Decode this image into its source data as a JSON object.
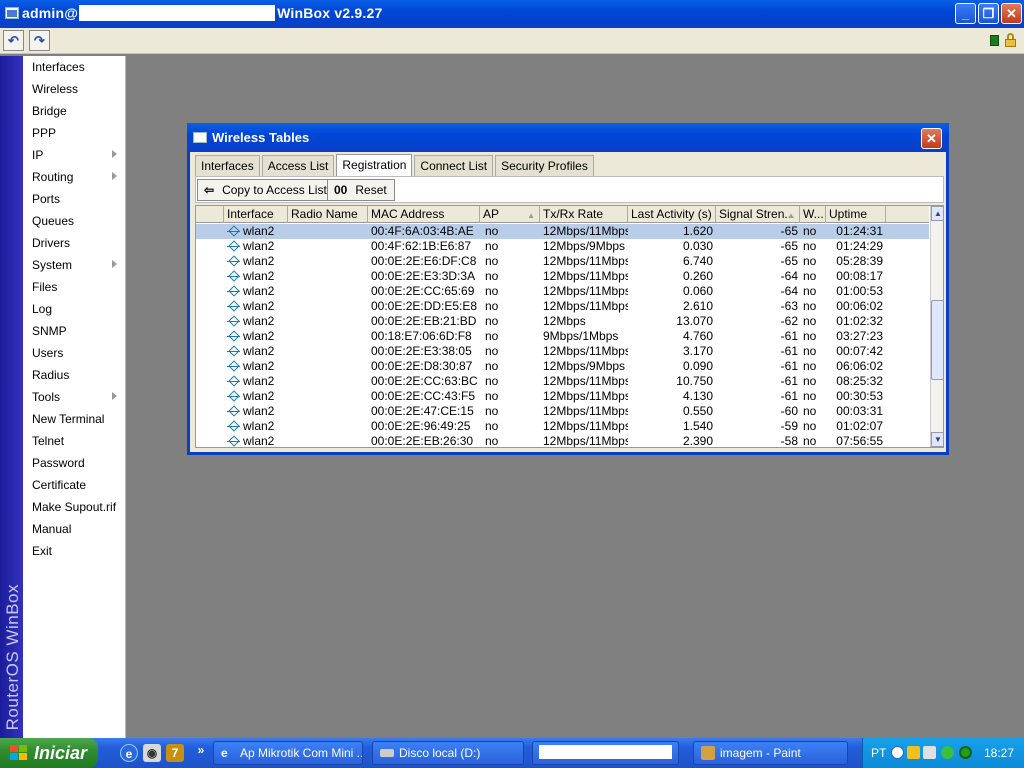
{
  "window": {
    "title_prefix": "admin@",
    "title_suffix": "WinBox v2.9.27",
    "minimize": "_",
    "maximize": "❐",
    "close": "✕"
  },
  "toolbar": {
    "undo": "↶",
    "redo": "↷"
  },
  "brand": "RouterOS WinBox",
  "menu": {
    "items": [
      {
        "label": "Interfaces",
        "submenu": false
      },
      {
        "label": "Wireless",
        "submenu": false
      },
      {
        "label": "Bridge",
        "submenu": false
      },
      {
        "label": "PPP",
        "submenu": false
      },
      {
        "label": "IP",
        "submenu": true
      },
      {
        "label": "Routing",
        "submenu": true
      },
      {
        "label": "Ports",
        "submenu": false
      },
      {
        "label": "Queues",
        "submenu": false
      },
      {
        "label": "Drivers",
        "submenu": false
      },
      {
        "label": "System",
        "submenu": true
      },
      {
        "label": "Files",
        "submenu": false
      },
      {
        "label": "Log",
        "submenu": false
      },
      {
        "label": "SNMP",
        "submenu": false
      },
      {
        "label": "Users",
        "submenu": false
      },
      {
        "label": "Radius",
        "submenu": false
      },
      {
        "label": "Tools",
        "submenu": true
      },
      {
        "label": "New Terminal",
        "submenu": false
      },
      {
        "label": "Telnet",
        "submenu": false
      },
      {
        "label": "Password",
        "submenu": false
      },
      {
        "label": "Certificate",
        "submenu": false
      },
      {
        "label": "Make Supout.rif",
        "submenu": false
      },
      {
        "label": "Manual",
        "submenu": false
      },
      {
        "label": "Exit",
        "submenu": false
      }
    ]
  },
  "wireless_tables": {
    "title": "Wireless Tables",
    "close": "✕",
    "tabs": [
      {
        "label": "Interfaces",
        "active": false
      },
      {
        "label": "Access List",
        "active": false
      },
      {
        "label": "Registration",
        "active": true
      },
      {
        "label": "Connect List",
        "active": false
      },
      {
        "label": "Security Profiles",
        "active": false
      }
    ],
    "actions": {
      "copy_icon": "⇦",
      "copy_label": "Copy to Access List",
      "reset_icon": "00",
      "reset_label": "Reset"
    },
    "columns": [
      "Interface",
      "Radio Name",
      "MAC Address",
      "AP",
      "Tx/Rx Rate",
      "Last Activity (s)",
      "Signal Stren...",
      "W...",
      "Uptime"
    ],
    "rows": [
      {
        "interface": "wlan2",
        "radio_name": "",
        "mac": "00:4F:6A:03:4B:AE",
        "ap": "no",
        "rate": "12Mbps/11Mbps",
        "last_activity": "1.620",
        "signal": "-65",
        "w": "no",
        "uptime": "01:24:31",
        "selected": true
      },
      {
        "interface": "wlan2",
        "radio_name": "",
        "mac": "00:4F:62:1B:E6:87",
        "ap": "no",
        "rate": "12Mbps/9Mbps",
        "last_activity": "0.030",
        "signal": "-65",
        "w": "no",
        "uptime": "01:24:29",
        "selected": false
      },
      {
        "interface": "wlan2",
        "radio_name": "",
        "mac": "00:0E:2E:E6:DF:C8",
        "ap": "no",
        "rate": "12Mbps/11Mbps",
        "last_activity": "6.740",
        "signal": "-65",
        "w": "no",
        "uptime": "05:28:39",
        "selected": false
      },
      {
        "interface": "wlan2",
        "radio_name": "",
        "mac": "00:0E:2E:E3:3D:3A",
        "ap": "no",
        "rate": "12Mbps/11Mbps",
        "last_activity": "0.260",
        "signal": "-64",
        "w": "no",
        "uptime": "00:08:17",
        "selected": false
      },
      {
        "interface": "wlan2",
        "radio_name": "",
        "mac": "00:0E:2E:CC:65:69",
        "ap": "no",
        "rate": "12Mbps/11Mbps",
        "last_activity": "0.060",
        "signal": "-64",
        "w": "no",
        "uptime": "01:00:53",
        "selected": false
      },
      {
        "interface": "wlan2",
        "radio_name": "",
        "mac": "00:0E:2E:DD:E5:E8",
        "ap": "no",
        "rate": "12Mbps/11Mbps",
        "last_activity": "2.610",
        "signal": "-63",
        "w": "no",
        "uptime": "00:06:02",
        "selected": false
      },
      {
        "interface": "wlan2",
        "radio_name": "",
        "mac": "00:0E:2E:EB:21:BD",
        "ap": "no",
        "rate": "12Mbps",
        "last_activity": "13.070",
        "signal": "-62",
        "w": "no",
        "uptime": "01:02:32",
        "selected": false
      },
      {
        "interface": "wlan2",
        "radio_name": "",
        "mac": "00:18:E7:06:6D:F8",
        "ap": "no",
        "rate": "9Mbps/1Mbps",
        "last_activity": "4.760",
        "signal": "-61",
        "w": "no",
        "uptime": "03:27:23",
        "selected": false
      },
      {
        "interface": "wlan2",
        "radio_name": "",
        "mac": "00:0E:2E:E3:38:05",
        "ap": "no",
        "rate": "12Mbps/11Mbps",
        "last_activity": "3.170",
        "signal": "-61",
        "w": "no",
        "uptime": "00:07:42",
        "selected": false
      },
      {
        "interface": "wlan2",
        "radio_name": "",
        "mac": "00:0E:2E:D8:30:87",
        "ap": "no",
        "rate": "12Mbps/9Mbps",
        "last_activity": "0.090",
        "signal": "-61",
        "w": "no",
        "uptime": "06:06:02",
        "selected": false
      },
      {
        "interface": "wlan2",
        "radio_name": "",
        "mac": "00:0E:2E:CC:63:BC",
        "ap": "no",
        "rate": "12Mbps/11Mbps",
        "last_activity": "10.750",
        "signal": "-61",
        "w": "no",
        "uptime": "08:25:32",
        "selected": false
      },
      {
        "interface": "wlan2",
        "radio_name": "",
        "mac": "00:0E:2E:CC:43:F5",
        "ap": "no",
        "rate": "12Mbps/11Mbps",
        "last_activity": "4.130",
        "signal": "-61",
        "w": "no",
        "uptime": "00:30:53",
        "selected": false
      },
      {
        "interface": "wlan2",
        "radio_name": "",
        "mac": "00:0E:2E:47:CE:15",
        "ap": "no",
        "rate": "12Mbps/11Mbps",
        "last_activity": "0.550",
        "signal": "-60",
        "w": "no",
        "uptime": "00:03:31",
        "selected": false
      },
      {
        "interface": "wlan2",
        "radio_name": "",
        "mac": "00:0E:2E:96:49:25",
        "ap": "no",
        "rate": "12Mbps/11Mbps",
        "last_activity": "1.540",
        "signal": "-59",
        "w": "no",
        "uptime": "01:02:07",
        "selected": false
      },
      {
        "interface": "wlan2",
        "radio_name": "",
        "mac": "00:0E:2E:EB:26:30",
        "ap": "no",
        "rate": "12Mbps/11Mbps",
        "last_activity": "2.390",
        "signal": "-58",
        "w": "no",
        "uptime": "07:56:55",
        "selected": false
      }
    ]
  },
  "taskbar": {
    "start_label": "Iniciar",
    "quick_more": "»",
    "tasks": [
      "Ap Mikrotik Com Mini ...",
      "Disco local (D:)",
      "",
      "imagem - Paint"
    ],
    "language": "PT",
    "clock": "18:27"
  },
  "colors": {
    "xp_blue": "#0a3fc4",
    "selection": "#b9cde9",
    "brand_strip": "#2a2ab0",
    "start_green": "#2f8f2f"
  }
}
